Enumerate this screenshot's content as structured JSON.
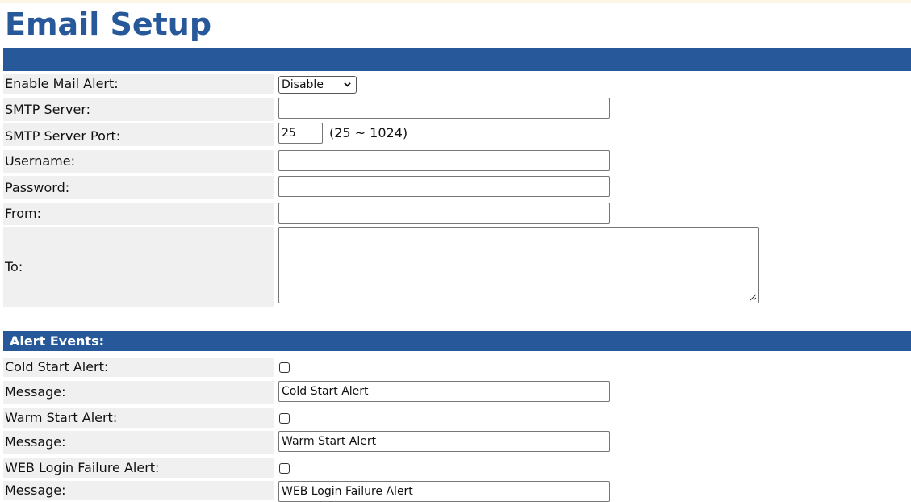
{
  "page_title": "Email Setup",
  "fields": {
    "enable_mail_alert": {
      "label": "Enable Mail Alert:",
      "selected": "Disable"
    },
    "smtp_server": {
      "label": "SMTP Server:",
      "value": ""
    },
    "smtp_port": {
      "label": "SMTP Server Port:",
      "value": "25",
      "range": "(25 ~ 1024)"
    },
    "username": {
      "label": "Username:",
      "value": ""
    },
    "password": {
      "label": "Password:",
      "value": ""
    },
    "from": {
      "label": "From:",
      "value": ""
    },
    "to": {
      "label": "To:",
      "value": ""
    }
  },
  "alert_events": {
    "heading": "Alert Events:",
    "items": [
      {
        "label": "Cold Start Alert:",
        "checked": false,
        "message_label": "Message:",
        "message": "Cold Start Alert"
      },
      {
        "label": "Warm Start Alert:",
        "checked": false,
        "message_label": "Message:",
        "message": "Warm Start Alert"
      },
      {
        "label": "WEB Login Failure Alert:",
        "checked": false,
        "message_label": "Message:",
        "message": "WEB Login Failure Alert"
      }
    ]
  },
  "colors": {
    "header_bar": "#27589a",
    "title_text": "#27589a",
    "label_background": "#f0f0f0"
  },
  "icons": {
    "select_chevron": "chevron-down-icon",
    "resize_grip": "resize-grip-icon"
  }
}
